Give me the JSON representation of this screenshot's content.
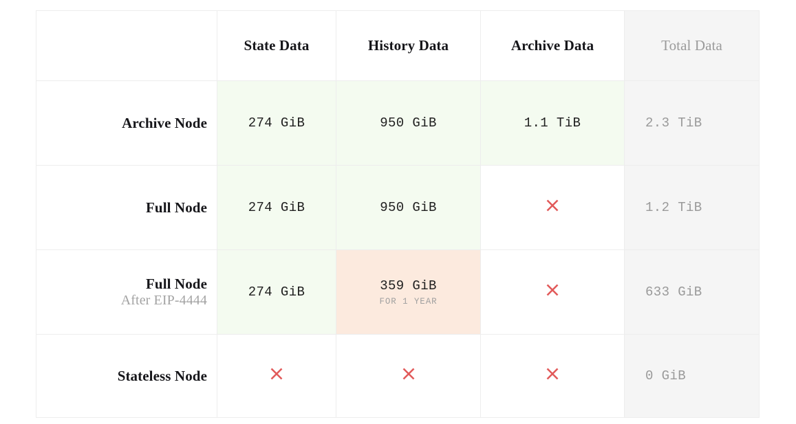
{
  "table": {
    "columns": [
      {
        "key": "label",
        "label": ""
      },
      {
        "key": "state",
        "label": "State Data"
      },
      {
        "key": "history",
        "label": "History Data"
      },
      {
        "key": "archive",
        "label": "Archive Data"
      },
      {
        "key": "total",
        "label": "Total Data"
      }
    ],
    "rows": [
      {
        "label": "Archive Node",
        "sublabel": "",
        "state": {
          "value": "274 GiB",
          "note": "",
          "mark": "text"
        },
        "history": {
          "value": "950 GiB",
          "note": "",
          "mark": "text"
        },
        "archive": {
          "value": "1.1 TiB",
          "note": "",
          "mark": "text"
        },
        "total": {
          "value": "2.3 TiB",
          "note": "",
          "mark": "text"
        }
      },
      {
        "label": "Full Node",
        "sublabel": "",
        "state": {
          "value": "274 GiB",
          "note": "",
          "mark": "text"
        },
        "history": {
          "value": "950 GiB",
          "note": "",
          "mark": "text"
        },
        "archive": {
          "value": "",
          "note": "",
          "mark": "x"
        },
        "total": {
          "value": "1.2 TiB",
          "note": "",
          "mark": "text"
        }
      },
      {
        "label": "Full Node",
        "sublabel": "After EIP-4444",
        "state": {
          "value": "274 GiB",
          "note": "",
          "mark": "text"
        },
        "history": {
          "value": "359 GiB",
          "note": "FOR 1 YEAR",
          "mark": "text"
        },
        "archive": {
          "value": "",
          "note": "",
          "mark": "x"
        },
        "total": {
          "value": "633 GiB",
          "note": "",
          "mark": "text"
        }
      },
      {
        "label": "Stateless Node",
        "sublabel": "",
        "state": {
          "value": "",
          "note": "",
          "mark": "x"
        },
        "history": {
          "value": "",
          "note": "",
          "mark": "x"
        },
        "archive": {
          "value": "",
          "note": "",
          "mark": "x"
        },
        "total": {
          "value": "0 GiB",
          "note": "",
          "mark": "text"
        }
      }
    ],
    "cell_backgrounds": [
      [
        "white",
        "green",
        "green",
        "green",
        "gray"
      ],
      [
        "white",
        "green",
        "green",
        "white",
        "gray"
      ],
      [
        "white",
        "green",
        "orange",
        "white",
        "gray"
      ],
      [
        "white",
        "white",
        "white",
        "white",
        "gray"
      ]
    ]
  },
  "icons": {
    "unavailable": "x-mark-icon"
  },
  "colors": {
    "green_cell": "#f4fbf0",
    "orange_cell": "#fceade",
    "gray_cell": "#f5f5f5",
    "x_mark": "#e25a5a",
    "text_primary": "#16161a",
    "text_muted": "#9a9a9a",
    "border": "#ededed"
  }
}
